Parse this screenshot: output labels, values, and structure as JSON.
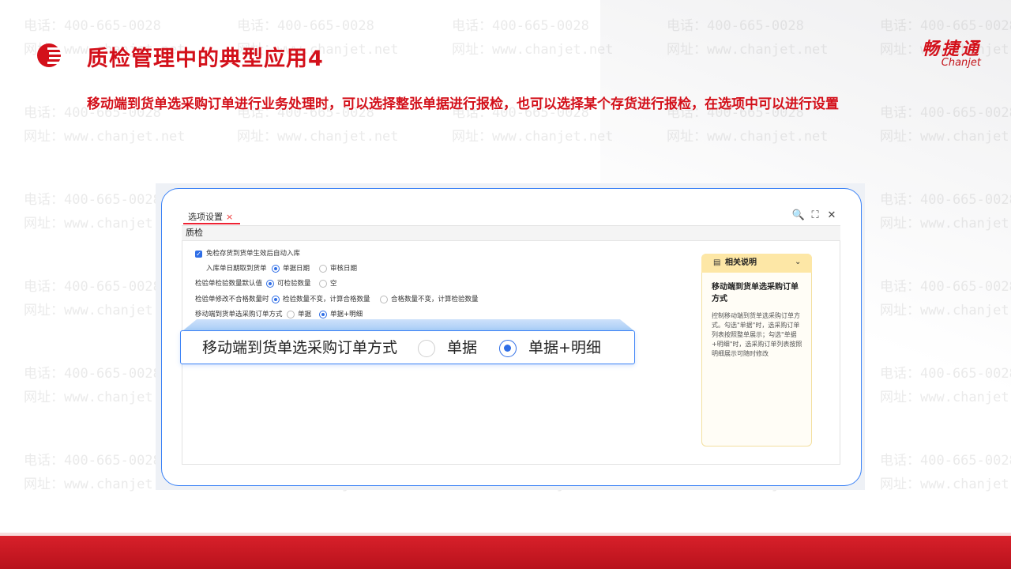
{
  "watermark": {
    "phone": "电话：400-665-0028",
    "site": "网址：www.chanjet.net"
  },
  "header": {
    "title": "质检管理中的典型应用4",
    "brand_cn": "畅捷通",
    "brand_en": "Chanjet"
  },
  "description": "移动端到货单选采购订单进行业务处理时，可以选择整张单据进行报检，也可以选择某个存货进行报检，在选项中可以进行设置",
  "window": {
    "tab_label": "选项设置",
    "tab_close": "×",
    "section": "质检",
    "controls": {
      "search": "🔍",
      "maximize": "⛶",
      "close": "✕"
    }
  },
  "form": {
    "row1_label": "免检存货到货单生效后自动入库",
    "row2_label": "入库单日期取到货单",
    "row2_opt1": "单据日期",
    "row2_opt2": "审核日期",
    "row3_label": "检验单检验数量默认值",
    "row3_opt1": "可检验数量",
    "row3_opt2": "空",
    "row4_label": "检验单修改不合格数量时",
    "row4_opt1": "检验数量不变，计算合格数量",
    "row4_opt2": "合格数量不变，计算检验数量",
    "row5_label": "移动端到货单选采购订单方式",
    "row5_opt1": "单据",
    "row5_opt2": "单据+明细"
  },
  "zoom": {
    "label": "移动端到货单选采购订单方式",
    "opt1": "单据",
    "opt2": "单据+明细",
    "selected": "单据+明细"
  },
  "help": {
    "title": "相关说明",
    "subtitle": "移动端到货单选采购订单方式",
    "body": "控制移动端到货单选采购订单方式。勾选\"单据\"时，选采购订单列表按照整单展示；勾选\"单据+明细\"时，选采购订单列表按照明细展示可随时修改"
  },
  "colors": {
    "accent": "#d3101a",
    "primary_blue": "#2f6ee6"
  }
}
